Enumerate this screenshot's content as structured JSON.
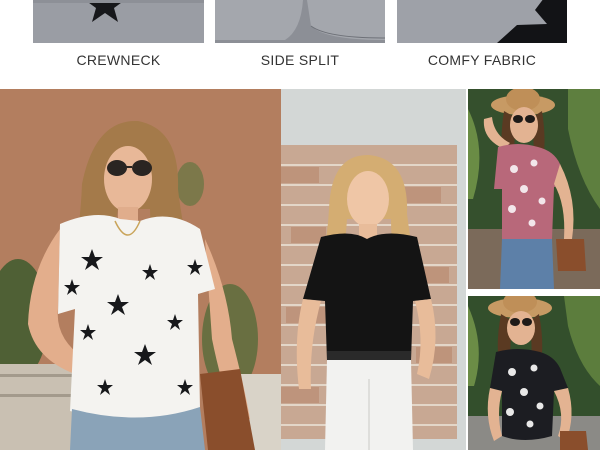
{
  "features": [
    {
      "label": "CREWNECK",
      "icon": "star-pattern-crewneck-closeup"
    },
    {
      "label": "SIDE SPLIT",
      "icon": "side-split-hem-closeup"
    },
    {
      "label": "COMFY FABRIC",
      "icon": "star-fabric-closeup"
    }
  ],
  "photos": [
    {
      "name": "model-white-star-top",
      "shirt_color": "#f4f3f0"
    },
    {
      "name": "model-black-top-brick-wall",
      "shirt_color": "#141414"
    },
    {
      "name": "model-pink-print-top",
      "shirt_color": "#b8687a"
    },
    {
      "name": "model-black-print-top",
      "shirt_color": "#1c1d22"
    }
  ],
  "colors": {
    "feature_gray": "#9b9ea5",
    "wall_terracotta": "#b0785a",
    "brick": "#c4a38c",
    "foliage": "#2f4a2a"
  }
}
